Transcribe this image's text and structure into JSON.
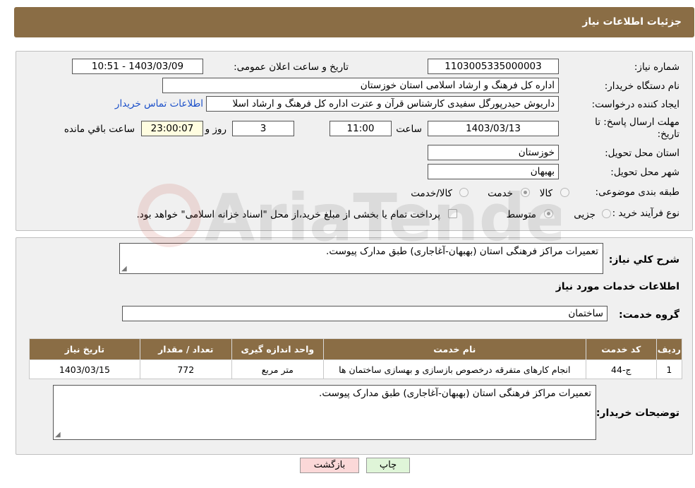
{
  "header": {
    "title": "جزئیات اطلاعات نیاز"
  },
  "form": {
    "need_number": {
      "label": "شماره نیاز:",
      "value": "1103005335000003"
    },
    "announce_datetime": {
      "label": "تاریخ و ساعت اعلان عمومی:",
      "value": "1403/03/09 - 10:51"
    },
    "buyer_org": {
      "label": "نام دستگاه خریدار:",
      "value": "اداره کل فرهنگ و ارشاد اسلامی استان خوزستان"
    },
    "creator": {
      "label": "ایجاد کننده درخواست:",
      "value": "داریوش حیدرپورگل سفیدی کارشناس قرآن و عترت اداره کل فرهنگ و ارشاد اسلا"
    },
    "contact_link": "اطلاعات تماس خریدار",
    "deadline": {
      "label": "مهلت ارسال پاسخ: تا تاریخ:",
      "date": "1403/03/13",
      "time_label": "ساعت",
      "time": "11:00",
      "days": "3",
      "days_label": "روز و",
      "remaining": "23:00:07",
      "remaining_label": "ساعت باقي مانده"
    },
    "province": {
      "label": "استان محل تحویل:",
      "value": "خوزستان"
    },
    "city": {
      "label": "شهر محل تحویل:",
      "value": "بهبهان"
    },
    "category": {
      "label": "طبقه بندی موضوعی:",
      "options": [
        {
          "label": "کالا",
          "checked": false
        },
        {
          "label": "خدمت",
          "checked": true
        },
        {
          "label": "کالا/خدمت",
          "checked": false
        }
      ]
    },
    "purchase_type": {
      "label": "نوع فرآیند خرید :",
      "options": [
        {
          "label": "جزیی",
          "checked": false
        },
        {
          "label": "متوسط",
          "checked": true
        }
      ],
      "payment_note": "پرداخت تمام یا بخشی از مبلغ خرید،از محل \"اسناد خزانه اسلامی\" خواهد بود."
    }
  },
  "details": {
    "summary_label": "شرح کلي نیاز:",
    "summary_value": "تعمیرات مراکز فرهنگی استان (بهبهان-آغاجاری) طبق مدارک پیوست.",
    "services_title": "اطلاعات خدمات مورد نیاز",
    "service_group_label": "گروه خدمت:",
    "service_group_value": "ساختمان",
    "table": {
      "headers": [
        "ردیف",
        "کد خدمت",
        "نام خدمت",
        "واحد اندازه گیری",
        "تعداد / مقدار",
        "تاریخ نیاز"
      ],
      "rows": [
        [
          "1",
          "ج-44",
          "انجام کارهای متفرقه درخصوص بازسازی و بهسازی ساختمان ها",
          "متر مربع",
          "772",
          "1403/03/15"
        ]
      ]
    },
    "buyer_notes_label": "توضیحات خریدار:",
    "buyer_notes_value": "تعمیرات مراکز فرهنگی استان (بهبهان-آغاجاری) طبق مدارک پیوست."
  },
  "buttons": {
    "print": "چاپ",
    "back": "بازگشت"
  },
  "watermark": "AriaTender.neT"
}
